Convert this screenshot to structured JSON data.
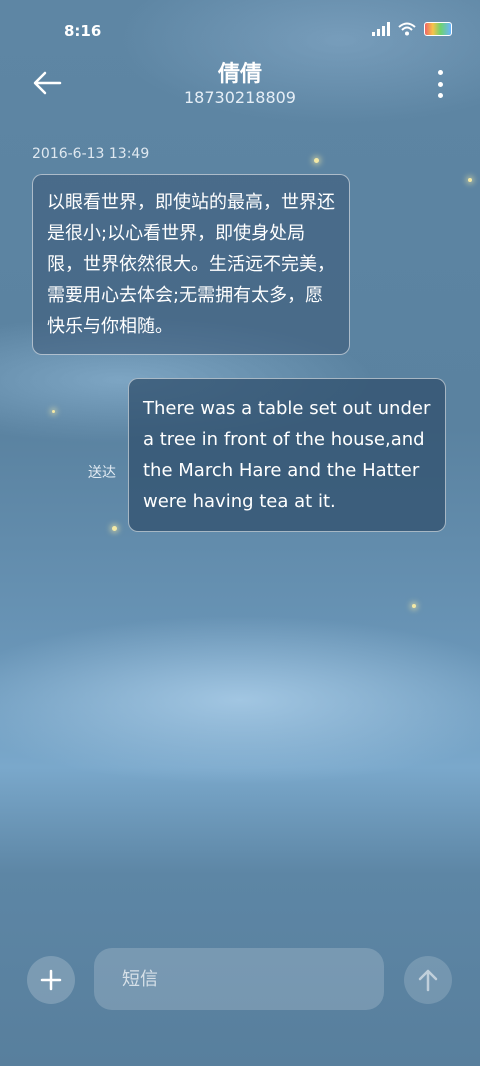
{
  "status_bar": {
    "time": "8:16"
  },
  "header": {
    "contact_name": "倩倩",
    "phone_number": "18730218809"
  },
  "conversation": {
    "timestamp": "2016-6-13 13:49",
    "messages": [
      {
        "direction": "incoming",
        "text": "以眼看世界，即使站的最高，世界还是很小;以心看世界，即使身处局限，世界依然很大。生活远不完美，需要用心去体会;无需拥有太多，愿快乐与你相随。"
      },
      {
        "direction": "outgoing",
        "text": "There was a table set out under a tree in front of the house,and the March Hare and the Hatter were having tea at it.",
        "status": "送达"
      }
    ]
  },
  "composer": {
    "placeholder": "短信"
  },
  "icons": {
    "back": "back-arrow-icon",
    "more": "more-vertical-icon",
    "add": "plus-icon",
    "send": "send-arrow-up-icon"
  }
}
